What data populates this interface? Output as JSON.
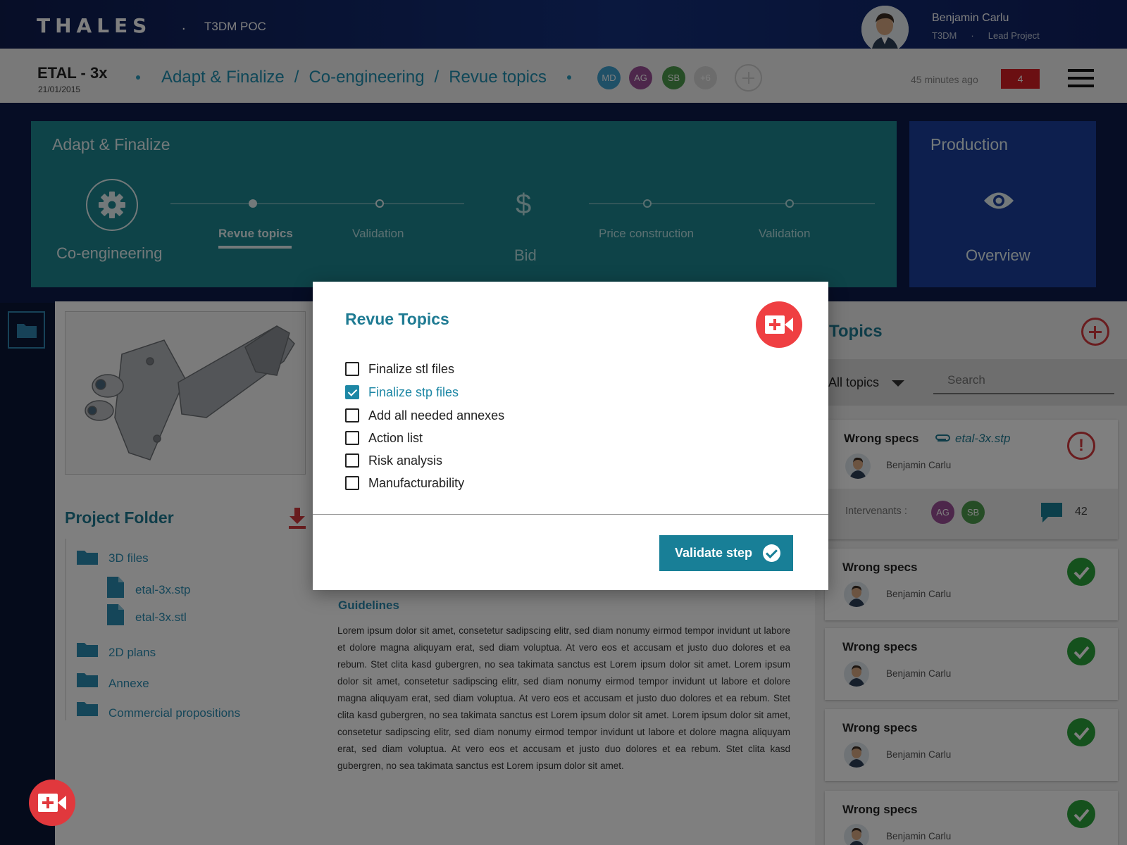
{
  "header": {
    "logo": "THALES",
    "separator": ".",
    "app_name": "T3DM POC",
    "user": {
      "name": "Benjamin Carlu",
      "org": "T3DM",
      "dot": "·",
      "role": "Lead Project"
    }
  },
  "project_bar": {
    "title": "ETAL - 3x",
    "date": "21/01/2015",
    "breadcrumb": [
      "Adapt & Finalize",
      "Co-engineering",
      "Revue topics"
    ],
    "breadcrumb_sep": "/",
    "participants": [
      {
        "initials": "MD",
        "color": "#3ea0cf"
      },
      {
        "initials": "AG",
        "color": "#9b4f96"
      },
      {
        "initials": "SB",
        "color": "#4d9a4d"
      },
      {
        "initials": "+6",
        "color": "#d9d9d9"
      }
    ],
    "last_update": "45 minutes ago",
    "notifications": "4"
  },
  "workflow": {
    "phase": "Adapt & Finalize",
    "steps": {
      "coengineering": "Co-engineering",
      "revue_topics": "Revue topics",
      "validation_1": "Validation",
      "bid_symbol": "$",
      "bid": "Bid",
      "price_construction": "Price construction",
      "validation_2": "Validation"
    },
    "production": {
      "title": "Production",
      "overview": "Overview"
    }
  },
  "project_folder": {
    "title": "Project Folder",
    "items": {
      "3d": "3D files",
      "stp": "etal-3x.stp",
      "stl": "etal-3x.stl",
      "2d": "2D plans",
      "annexe": "Annexe",
      "commercial": "Commercial propositions"
    }
  },
  "guidelines": {
    "title": "Guidelines",
    "text": "Lorem ipsum dolor sit amet, consetetur sadipscing elitr, sed diam nonumy eirmod tempor invidunt ut labore et dolore magna aliquyam erat, sed diam voluptua. At vero eos et accusam et justo duo dolores et ea rebum. Stet clita kasd gubergren, no sea takimata sanctus est Lorem ipsum dolor sit amet. Lorem ipsum dolor sit amet, consetetur sadipscing elitr, sed diam nonumy eirmod tempor invidunt ut labore et dolore magna aliquyam erat, sed diam voluptua. At vero eos et accusam et justo duo dolores et ea rebum. Stet clita kasd gubergren, no sea takimata sanctus est Lorem ipsum dolor sit amet. Lorem ipsum dolor sit amet, consetetur sadipscing elitr, sed diam nonumy eirmod tempor invidunt ut labore et dolore magna aliquyam erat, sed diam voluptua. At vero eos et accusam et justo duo dolores et ea rebum. Stet clita kasd gubergren, no sea takimata sanctus est Lorem ipsum dolor sit amet."
  },
  "topics": {
    "title": "Topics",
    "filter": "All topics",
    "search_placeholder": "Search",
    "cards": [
      {
        "title": "Wrong specs",
        "attachment": "etal-3x.stp",
        "user": "Benjamin Carlu",
        "status": "warning",
        "intervenants_label": "Intervenants :",
        "intervenants": [
          "AG",
          "SB"
        ],
        "comments": "42"
      },
      {
        "title": "Wrong specs",
        "user": "Benjamin Carlu",
        "status": "ok"
      },
      {
        "title": "Wrong specs",
        "user": "Benjamin Carlu",
        "status": "ok"
      },
      {
        "title": "Wrong specs",
        "user": "Benjamin Carlu",
        "status": "ok"
      },
      {
        "title": "Wrong specs",
        "user": "Benjamin Carlu",
        "status": "ok"
      }
    ],
    "warning_glyph": "!"
  },
  "modal": {
    "title": "Revue Topics",
    "items": [
      {
        "label": "Finalize stl files",
        "checked": false
      },
      {
        "label": "Finalize stp files",
        "checked": true
      },
      {
        "label": "Add all needed annexes",
        "checked": false
      },
      {
        "label": "Action list",
        "checked": false
      },
      {
        "label": "Risk analysis",
        "checked": false
      },
      {
        "label": "Manufacturability",
        "checked": false
      }
    ],
    "validate_label": "Validate step"
  },
  "colors": {
    "accent": "#1f7b93",
    "danger": "#d43a3f",
    "ok": "#2aa33a",
    "phase_bg": "#1d8690",
    "production_bg": "#1a3f9c"
  }
}
